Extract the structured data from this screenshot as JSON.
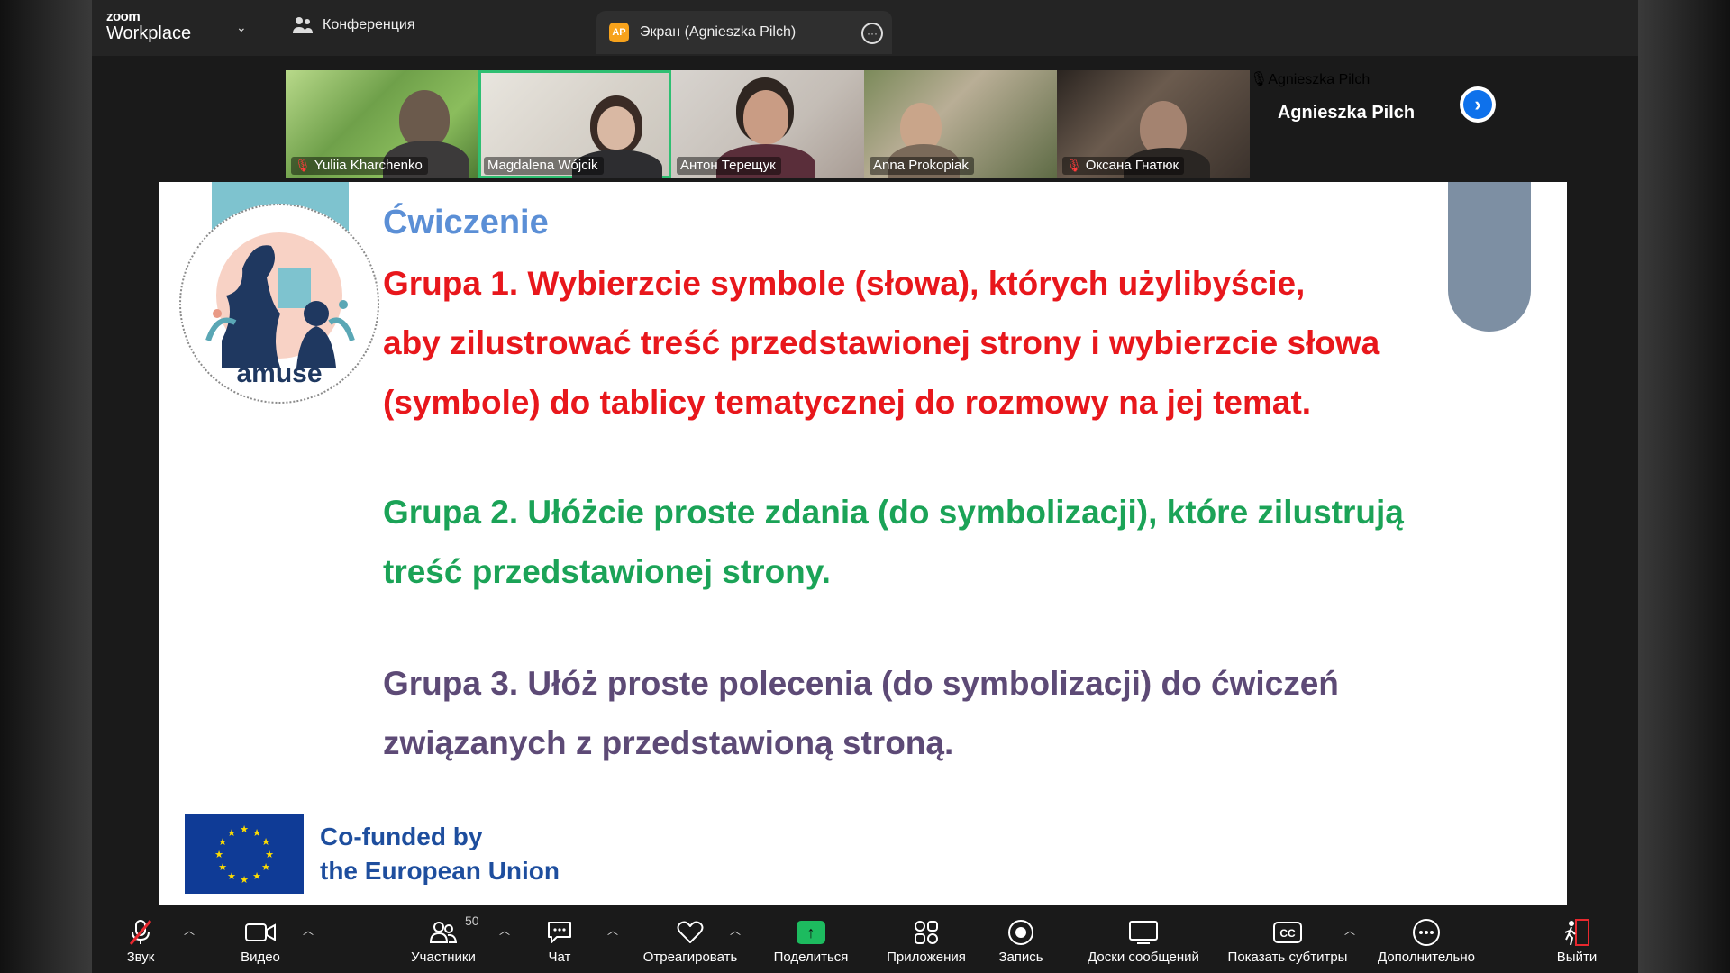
{
  "topbar": {
    "logo_zoom": "zoom",
    "logo_product": "Workplace",
    "conference_tab": "Конференция",
    "screen_tab": "Экран (Agnieszka Pilch)",
    "screen_badge": "AP"
  },
  "gallery": {
    "participants": [
      {
        "name": "Yuliia Kharchenko",
        "muted": true
      },
      {
        "name": "Magdalena Wójcik",
        "muted": false,
        "active_speaker": true
      },
      {
        "name": "Антон Терещук",
        "muted": false
      },
      {
        "name": "Anna Prokopiak",
        "muted": false
      },
      {
        "name": "Оксана Гнатюк",
        "muted": true
      },
      {
        "name": "Agnieszka Pilch",
        "muted": true,
        "video_off": true
      }
    ],
    "next_arrow": "›"
  },
  "slide": {
    "title": "Ćwiczenie",
    "logo_text": "amuse",
    "group1_line1": "Grupa 1. Wybierzcie symbole (słowa), których użylibyście,",
    "group1_line2": "aby zilustrować treść przedstawionej strony i wybierzcie słowa",
    "group1_line3": "(symbole) do tablicy tematycznej do rozmowy na jej temat.",
    "group2_line1": "Grupa 2. Ułóżcie proste zdania (do symbolizacji), które zilustrują",
    "group2_line2": "treść przedstawionej strony.",
    "group3_line1": "Grupa 3. Ułóż proste polecenia (do symbolizacji) do ćwiczeń",
    "group3_line2": "związanych z przedstawioną stroną.",
    "eu_line1": "Co-funded by",
    "eu_line2": "the European Union",
    "colors": {
      "title": "#5b8fd6",
      "group1": "#e8171c",
      "group2": "#1ba357",
      "group3": "#5d4a76"
    }
  },
  "toolbar": {
    "audio": "Звук",
    "video": "Видео",
    "participants": "Участники",
    "participants_count": "50",
    "chat": "Чат",
    "react": "Отреагировать",
    "share": "Поделиться",
    "apps": "Приложения",
    "record": "Запись",
    "whiteboards": "Доски сообщений",
    "captions": "Показать субтитры",
    "more": "Дополнительно",
    "leave": "Выйти"
  }
}
